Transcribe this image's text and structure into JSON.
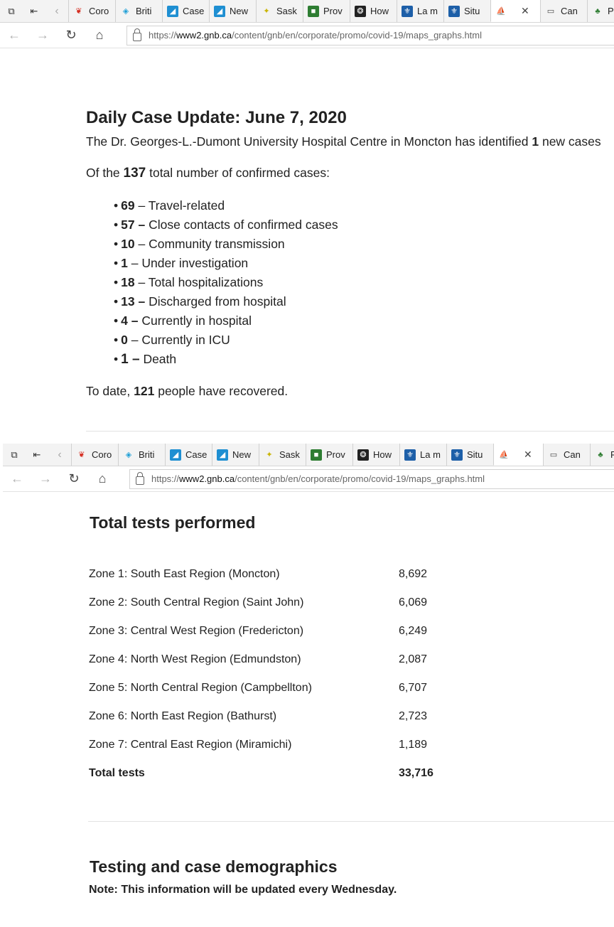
{
  "browser": {
    "tabs": [
      {
        "label": "Coro",
        "icon": "maple-leaf-icon"
      },
      {
        "label": "Briti",
        "icon": "bc-icon"
      },
      {
        "label": "Case",
        "icon": "alberta-icon"
      },
      {
        "label": "New",
        "icon": "alberta-icon"
      },
      {
        "label": "Sask",
        "icon": "sask-icon"
      },
      {
        "label": "Prov",
        "icon": "manitoba-icon"
      },
      {
        "label": "How",
        "icon": "ontario-icon"
      },
      {
        "label": "La m",
        "icon": "quebec-icon"
      },
      {
        "label": "Situ",
        "icon": "quebec-icon"
      },
      {
        "label": "",
        "icon": "nb-icon",
        "active": true
      },
      {
        "label": "Can",
        "icon": "window-icon"
      },
      {
        "label": "P",
        "icon": "pei-icon"
      }
    ],
    "url": {
      "proto": "https://",
      "host": "www2.gnb.ca",
      "path": "/content/gnb/en/corporate/promo/covid-19/maps_graphs.html"
    },
    "colors": {
      "tabbar_bg": "#f3f3f3",
      "active_tab_bg": "#ffffff"
    }
  },
  "daily": {
    "title": "Daily Case Update: June 7, 2020",
    "intro_pre": "The Dr. Georges-L.-Dumont University Hospital Centre in Moncton has identified ",
    "intro_num": "1",
    "intro_post": " new cases",
    "ofthe_pre": "Of the ",
    "ofthe_num": "137",
    "ofthe_post": " total number of confirmed cases:",
    "stats": [
      {
        "num": "69",
        "dash": " – ",
        "label": "Travel-related"
      },
      {
        "num": "57 –",
        "dash": " ",
        "label": "Close contacts of confirmed cases"
      },
      {
        "num": "10",
        "dash": " – ",
        "label": "Community transmission"
      },
      {
        "num": "1",
        "dash": " – ",
        "label": "Under investigation"
      },
      {
        "num": "18",
        "dash": " – ",
        "label": "Total hospitalizations"
      },
      {
        "num": "13 –",
        "dash": " ",
        "label": "Discharged from hospital"
      },
      {
        "num": "4 –",
        "dash": " ",
        "label": "Currently in hospital"
      },
      {
        "num": "0",
        "dash": " – ",
        "label": "Currently in ICU"
      },
      {
        "num": "1 –",
        "dash": " ",
        "label": "Death"
      }
    ],
    "recovered_pre": "To date, ",
    "recovered_num": "121",
    "recovered_post": " people have recovered."
  },
  "tests": {
    "title": "Total tests performed",
    "zones": [
      {
        "name": "Zone 1: South East Region (Moncton)",
        "value": "8,692"
      },
      {
        "name": "Zone 2: South Central Region (Saint John)",
        "value": "6,069"
      },
      {
        "name": "Zone 3: Central West Region (Fredericton)",
        "value": "6,249"
      },
      {
        "name": "Zone 4: North West Region (Edmundston)",
        "value": "2,087"
      },
      {
        "name": "Zone 5: North Central Region (Campbellton)",
        "value": "6,707"
      },
      {
        "name": "Zone 6: North East Region (Bathurst)",
        "value": "2,723"
      },
      {
        "name": "Zone 7: Central East Region (Miramichi)",
        "value": "1,189"
      }
    ],
    "total_label": "Total tests",
    "total_value": "33,716"
  },
  "demographics": {
    "title": "Testing and case demographics",
    "note": "Note: This information will be updated every Wednesday."
  }
}
